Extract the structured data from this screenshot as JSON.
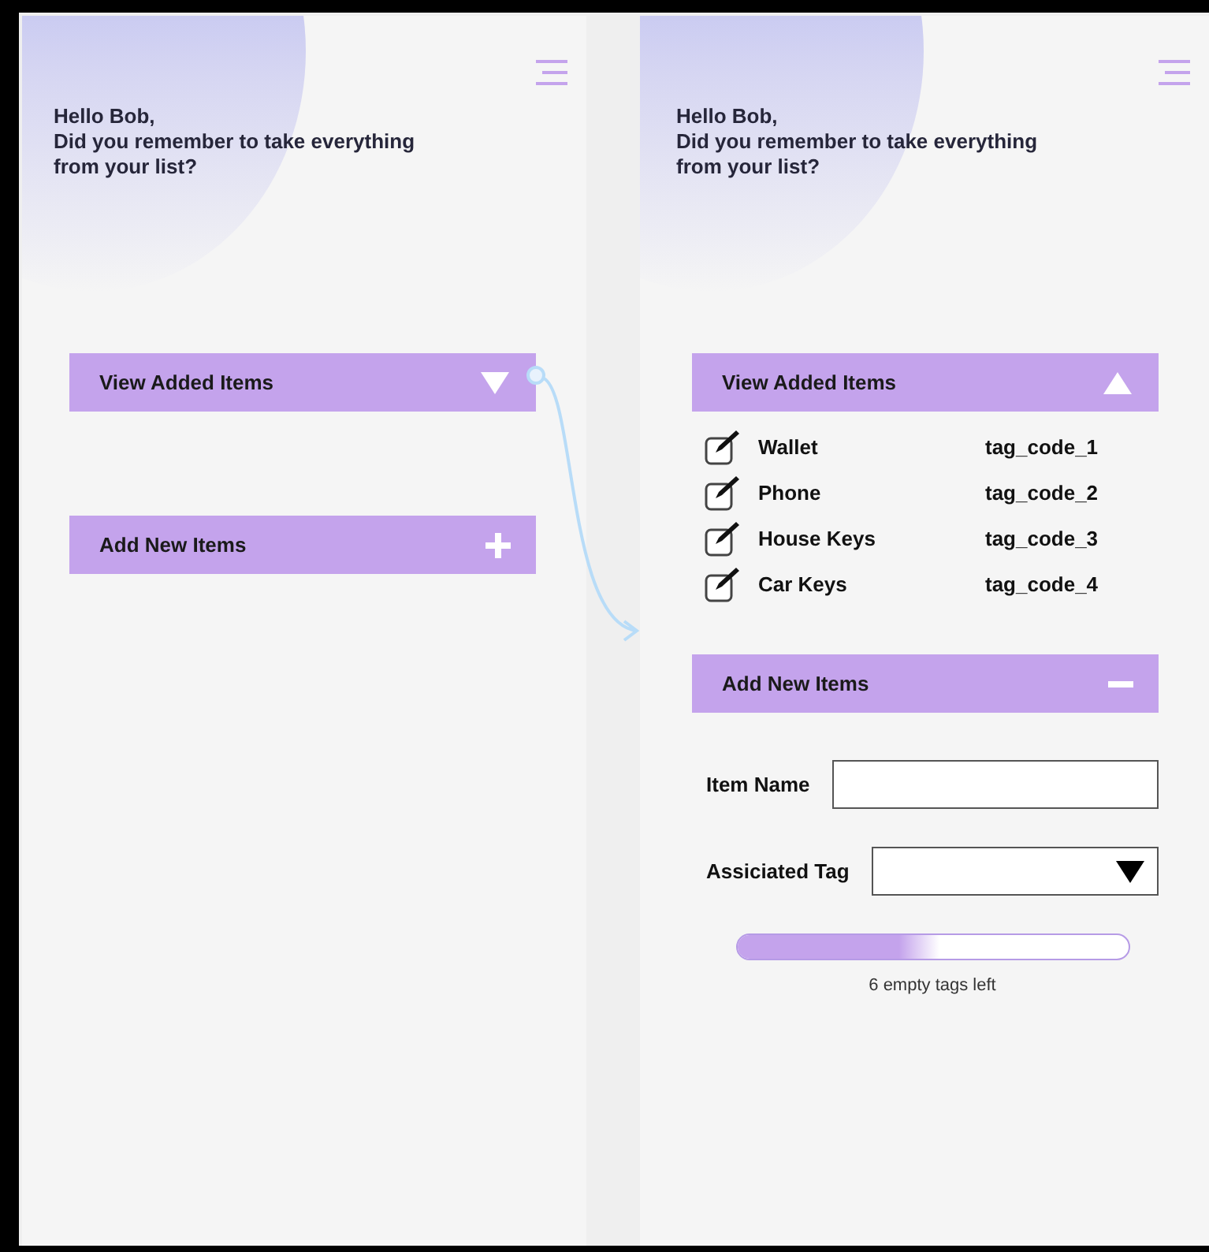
{
  "screens": [
    {
      "greeting": "Hello Bob,",
      "question": "Did you remember to take everything from your list?",
      "sections": [
        {
          "kind": "list",
          "title": "View Added Items",
          "expanded": false
        },
        {
          "kind": "form",
          "title": "Add New Items",
          "expanded": false
        }
      ]
    },
    {
      "greeting": "Hello Bob,",
      "question": "Did you remember to take everything from your list?",
      "sections": [
        {
          "kind": "list",
          "title": "View Added Items",
          "expanded": true,
          "items": [
            {
              "name": "Wallet",
              "tag": "tag_code_1",
              "checked": true
            },
            {
              "name": "Phone",
              "tag": "tag_code_2",
              "checked": true
            },
            {
              "name": "House Keys",
              "tag": "tag_code_3",
              "checked": true
            },
            {
              "name": "Car Keys",
              "tag": "tag_code_4",
              "checked": true
            }
          ]
        },
        {
          "kind": "form",
          "title": "Add New Items",
          "expanded": true,
          "fields": [
            {
              "kind": "text",
              "label": "Item Name"
            },
            {
              "kind": "select",
              "label": "Assiciated Tag"
            }
          ],
          "progress": {
            "level": 0.52,
            "caption": "6 empty tags left"
          }
        }
      ]
    }
  ]
}
